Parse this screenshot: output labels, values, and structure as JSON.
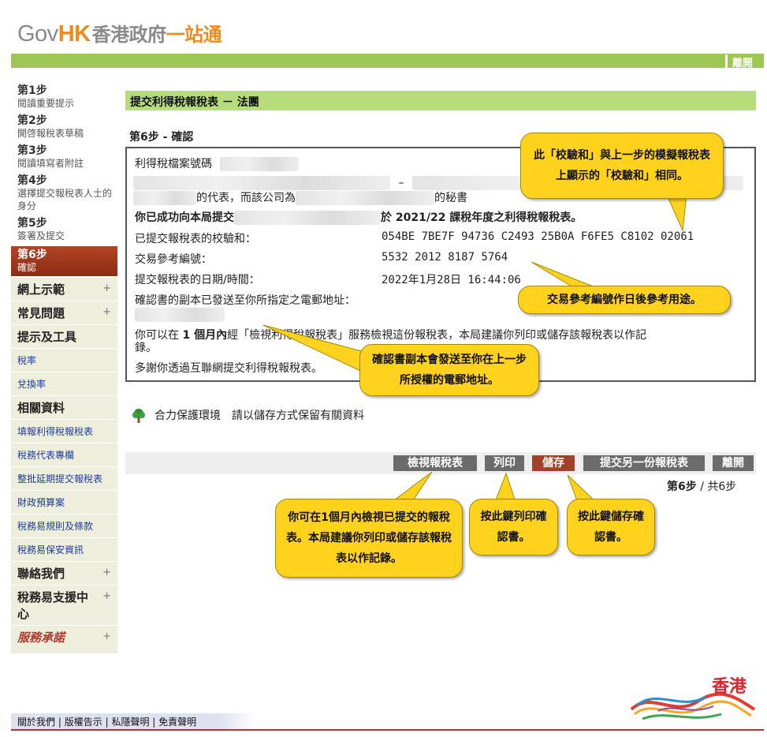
{
  "header": {
    "logo_gov": "Gov",
    "logo_hk": "HK",
    "logo_cn_part1": "香港政府",
    "logo_cn_part2": "一站通",
    "exit_label": "離開"
  },
  "sidebar": {
    "steps": [
      {
        "title": "第1步",
        "desc": "閱讀重要提示"
      },
      {
        "title": "第2步",
        "desc": "開啓報稅表草稿"
      },
      {
        "title": "第3步",
        "desc": "閱讀填寫者附註"
      },
      {
        "title": "第4步",
        "desc": "選擇提交報稅表人士的身分"
      },
      {
        "title": "第5步",
        "desc": "簽署及提交"
      },
      {
        "title": "第6步",
        "desc": "確認"
      }
    ],
    "menu_online_demo": "網上示範",
    "menu_faq": "常見問題",
    "menu_tools": "提示及工具",
    "link_tax_rates": "稅率",
    "link_exchange_rates": "兌換率",
    "menu_related": "相關資料",
    "link_fill_profits": "填報利得稅報稅表",
    "link_tax_rep": "稅務代表專欄",
    "link_bulk_extension": "整批延期提交報稅表",
    "link_budget": "財政預算案",
    "link_etax_terms": "稅務易規則及條款",
    "link_etax_security": "稅務易保安資訊",
    "menu_contact": "聯絡我們",
    "menu_support": "稅務易支援中心",
    "menu_calligraphy": "服務承諾",
    "plus_sign": "+"
  },
  "main": {
    "form_title": "提交利得稅報稅表  －  法團",
    "step_title": "第6步  -  確認",
    "file_no_label": "利得稅檔案號碼",
    "dash": "–",
    "representative_text": "的代表，而該公司為",
    "secretary_text": "的秘書",
    "success_prefix": "你已成功向本局提交",
    "success_suffix": "於 2021/22 課稅年度之利得稅報稅表。",
    "checksum_label": "已提交報稅表的校驗和：",
    "checksum_value": "054BE 7BE7F 94736 C2493 25B0A F6FE5 C8102 02061",
    "txn_label": "交易參考編號：",
    "txn_value": "5532 2012 8187 5764",
    "datetime_label": "提交報稅表的日期/時間：",
    "datetime_value": "2022年1月28日 16:44:06",
    "email_label": "確認書的副本已發送至你所指定之電郵地址：",
    "view_note_1": "你可以在",
    "view_note_bold": "1 個月內",
    "view_note_2": "經「檢視利得稅報稅表」服務檢視這份報稅表，本局建議你列印或儲存該報稅表以作記",
    "view_note_3": "錄。",
    "thanks": "多謝你透過互聯網提交利得稅報稅表。",
    "eco_text": "合力保護環境　請以儲存方式保留有關資料"
  },
  "buttons": {
    "view": "檢視報稅表",
    "print": "列印",
    "save": "儲存",
    "submit_another": "提交另一份報稅表",
    "exit": "離開"
  },
  "progress": {
    "current": "第6步",
    "total": "/ 共6步"
  },
  "callouts": {
    "checksum_note": "此「校驗和」與上一步的模擬報稅表上顯示的「校驗和」相同。",
    "txn_note": "交易參考編號作日後參考用途。",
    "email_note": "確認書副本會發送至你在上一步所授權的電郵地址。",
    "view_note": "你可在1個月內檢視已提交的報稅表。本局建議你列印或儲存該報稅表以作記錄。",
    "print_note": "按此鍵列印確認書。",
    "save_note": "按此鍵儲存確認書。"
  },
  "footer": {
    "about": "關於我們",
    "copyright": "版權告示",
    "privacy": "私隱聲明",
    "disclaimer": "免責聲明",
    "separator": "|",
    "brand_text": "香港"
  },
  "colors": {
    "green_bar": "#9dc654",
    "form_header": "#b7dd7a",
    "callout": "#ffd21e",
    "current_step": "#a23a1d",
    "save_button": "#a04229"
  }
}
